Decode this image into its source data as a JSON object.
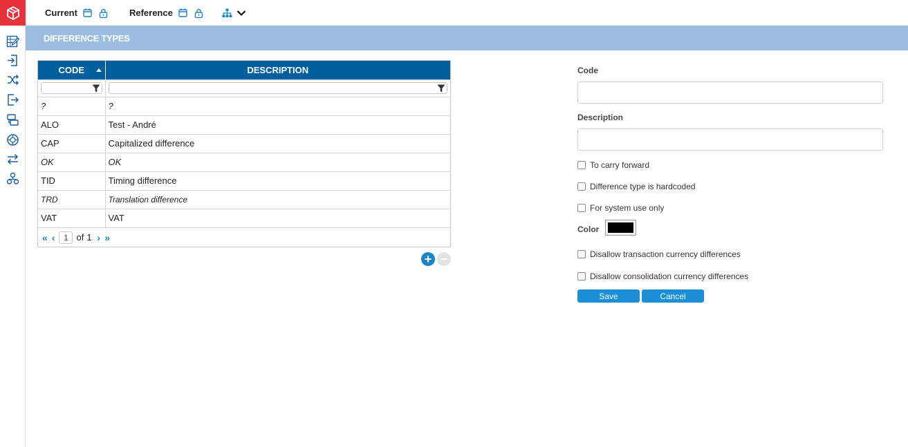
{
  "topbar": {
    "current_label": "Current",
    "reference_label": "Reference"
  },
  "section": {
    "title": "DIFFERENCE TYPES"
  },
  "grid": {
    "columns": [
      "CODE",
      "DESCRIPTION"
    ],
    "rows": [
      {
        "code": "?",
        "description": "?"
      },
      {
        "code": "ALO",
        "description": "Test - André"
      },
      {
        "code": "CAP",
        "description": "Capitalized difference"
      },
      {
        "code": "OK",
        "description": "OK"
      },
      {
        "code": "TID",
        "description": "Timing difference"
      },
      {
        "code": "TRD",
        "description": "Translation difference"
      },
      {
        "code": "VAT",
        "description": "VAT"
      }
    ],
    "pager": {
      "current_page": "1",
      "of_label": "of",
      "total_pages": "1"
    }
  },
  "form": {
    "code_label": "Code",
    "code_value": "",
    "description_label": "Description",
    "description_value": "",
    "to_carry_forward": "To carry forward",
    "hardcoded": "Difference type is hardcoded",
    "system_use_only": "For system use only",
    "color_label": "Color",
    "color_value": "#000000",
    "disallow_transaction": "Disallow transaction currency differences",
    "disallow_consolidation": "Disallow consolidation currency differences",
    "save_label": "Save",
    "cancel_label": "Cancel"
  },
  "colors": {
    "brand_red": "#e8323c",
    "header_blue": "#9bbde0",
    "grid_header": "#005f9e",
    "accent": "#1c84c6"
  }
}
